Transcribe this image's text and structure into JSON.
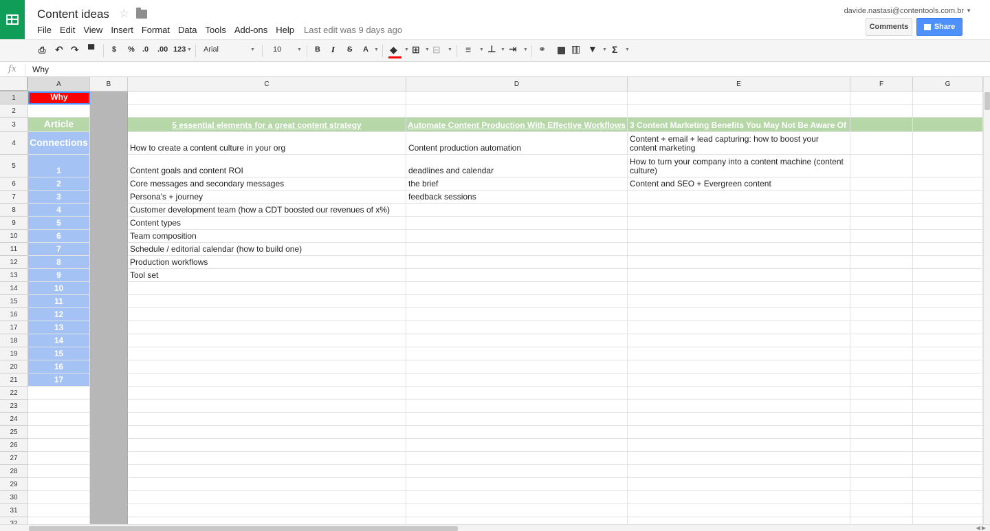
{
  "header": {
    "doc_title": "Content ideas",
    "menus": [
      "File",
      "Edit",
      "View",
      "Insert",
      "Format",
      "Data",
      "Tools",
      "Add-ons",
      "Help"
    ],
    "last_edit": "Last edit was 9 days ago",
    "user_email": "davide.nastasi@contentools.com.br",
    "comments_label": "Comments",
    "share_label": "Share"
  },
  "toolbar": {
    "currency": "$",
    "percent": "%",
    "decrease_decimals": ".0",
    "increase_decimals": ".00",
    "more_formats": "123",
    "font_name": "Arial",
    "font_size": "10",
    "bold": "B",
    "italic": "I",
    "strikethrough": "S",
    "text_color": "A",
    "functions": "Σ"
  },
  "formula_bar": {
    "fx": "fx",
    "value": "Why"
  },
  "grid": {
    "columns": [
      "A",
      "B",
      "C",
      "D",
      "E",
      "F",
      "G"
    ],
    "rows": [
      "1",
      "2",
      "3",
      "4",
      "5",
      "6",
      "7",
      "8",
      "9",
      "10",
      "11",
      "12",
      "13",
      "14",
      "15",
      "16",
      "17",
      "18",
      "19",
      "20",
      "21",
      "22",
      "23",
      "24",
      "25",
      "26",
      "27",
      "28",
      "29",
      "30",
      "31",
      "32"
    ],
    "a_cells": {
      "r1": "Why",
      "r3": "Article",
      "r4": "Connections",
      "numbers": [
        "1",
        "2",
        "3",
        "4",
        "5",
        "6",
        "7",
        "8",
        "9",
        "10",
        "11",
        "12",
        "13",
        "14",
        "15",
        "16",
        "17"
      ]
    },
    "row3": {
      "c": "5 essential elements for a great content strategy",
      "d": "Automate Content Production With Effective Workflows",
      "e": "3 Content Marketing Benefits You May Not Be Aware Of"
    },
    "col_c": [
      "How to create a content culture in your org",
      "Content goals and content ROI",
      "Core messages and secondary messages",
      "Persona's + journey",
      "Customer development team (how a CDT boosted our revenues of x%)",
      "Content types",
      "Team composition",
      "Schedule / editorial calendar (how to build one)",
      "Production workflows",
      "Tool set"
    ],
    "col_d": [
      "Content production automation",
      "deadlines and calendar",
      "the brief",
      "feedback sessions"
    ],
    "col_e": [
      "Content + email + lead capturing: how to boost your content marketing",
      "How to turn your company into a content machine (content culture)",
      "Content and SEO + Evergreen content"
    ]
  },
  "colors": {
    "brand_green": "#0f9d58",
    "row3_green": "#b6d7a8",
    "col_a_blue": "#a4c2f4",
    "col_b_gray": "#b7b7b7",
    "why_red": "#ff0000",
    "share_blue": "#4d90fe"
  }
}
